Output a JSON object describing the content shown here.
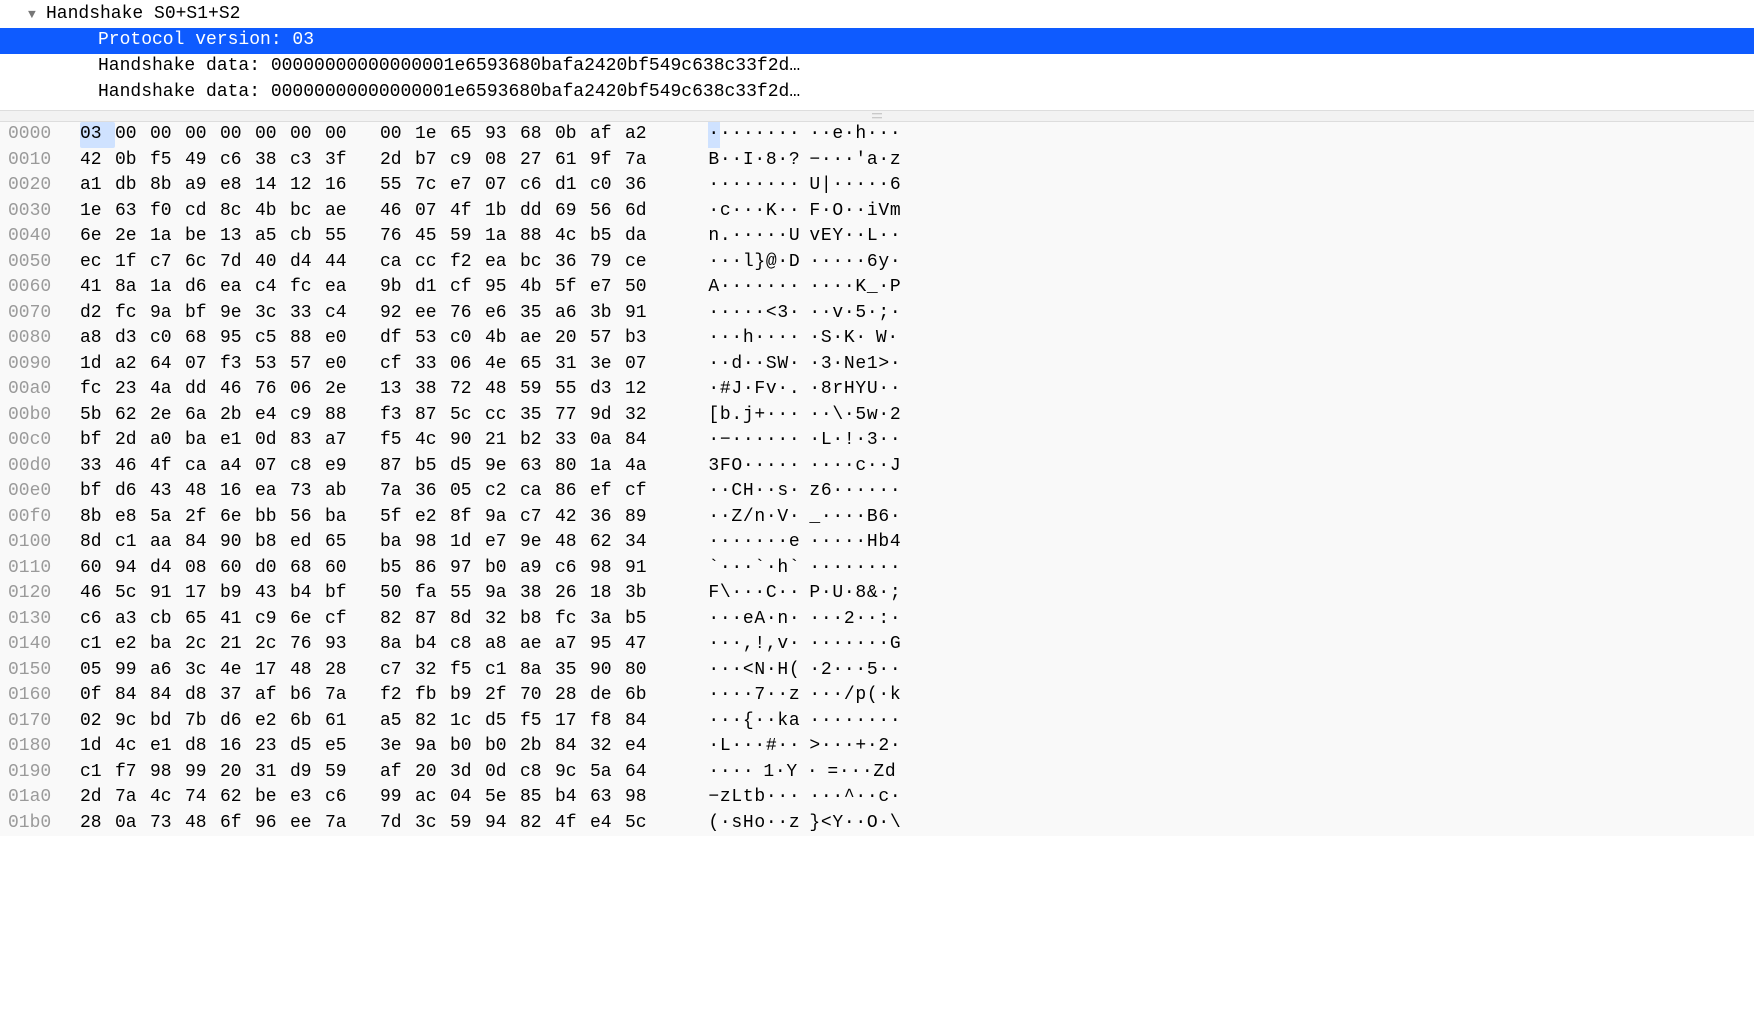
{
  "tree": {
    "root": {
      "label": "Handshake S0+S1+S2"
    },
    "version": {
      "label": "Protocol version: 03"
    },
    "hdata1": {
      "label": "Handshake data: 00000000000000001e6593680bafa2420bf549c638c33f2d…"
    },
    "hdata2": {
      "label": "Handshake data: 00000000000000001e6593680bafa2420bf549c638c33f2d…"
    }
  },
  "hex": {
    "selected": {
      "row": 0,
      "col": 0
    },
    "rows": [
      {
        "off": "0000",
        "b": [
          "03",
          "00",
          "00",
          "00",
          "00",
          "00",
          "00",
          "00",
          "00",
          "1e",
          "65",
          "93",
          "68",
          "0b",
          "af",
          "a2"
        ],
        "a": "········ ··e·h···"
      },
      {
        "off": "0010",
        "b": [
          "42",
          "0b",
          "f5",
          "49",
          "c6",
          "38",
          "c3",
          "3f",
          "2d",
          "b7",
          "c9",
          "08",
          "27",
          "61",
          "9f",
          "7a"
        ],
        "a": "B··I·8·? −···'a·z"
      },
      {
        "off": "0020",
        "b": [
          "a1",
          "db",
          "8b",
          "a9",
          "e8",
          "14",
          "12",
          "16",
          "55",
          "7c",
          "e7",
          "07",
          "c6",
          "d1",
          "c0",
          "36"
        ],
        "a": "········ U|·····6"
      },
      {
        "off": "0030",
        "b": [
          "1e",
          "63",
          "f0",
          "cd",
          "8c",
          "4b",
          "bc",
          "ae",
          "46",
          "07",
          "4f",
          "1b",
          "dd",
          "69",
          "56",
          "6d"
        ],
        "a": "·c···K·· F·O··iVm"
      },
      {
        "off": "0040",
        "b": [
          "6e",
          "2e",
          "1a",
          "be",
          "13",
          "a5",
          "cb",
          "55",
          "76",
          "45",
          "59",
          "1a",
          "88",
          "4c",
          "b5",
          "da"
        ],
        "a": "n.·····U vEY··L··"
      },
      {
        "off": "0050",
        "b": [
          "ec",
          "1f",
          "c7",
          "6c",
          "7d",
          "40",
          "d4",
          "44",
          "ca",
          "cc",
          "f2",
          "ea",
          "bc",
          "36",
          "79",
          "ce"
        ],
        "a": "···l}@·D ·····6y·"
      },
      {
        "off": "0060",
        "b": [
          "41",
          "8a",
          "1a",
          "d6",
          "ea",
          "c4",
          "fc",
          "ea",
          "9b",
          "d1",
          "cf",
          "95",
          "4b",
          "5f",
          "e7",
          "50"
        ],
        "a": "A······· ····K_·P"
      },
      {
        "off": "0070",
        "b": [
          "d2",
          "fc",
          "9a",
          "bf",
          "9e",
          "3c",
          "33",
          "c4",
          "92",
          "ee",
          "76",
          "e6",
          "35",
          "a6",
          "3b",
          "91"
        ],
        "a": "·····<3· ··v·5·;·"
      },
      {
        "off": "0080",
        "b": [
          "a8",
          "d3",
          "c0",
          "68",
          "95",
          "c5",
          "88",
          "e0",
          "df",
          "53",
          "c0",
          "4b",
          "ae",
          "20",
          "57",
          "b3"
        ],
        "a": "···h···· ·S·K· W·"
      },
      {
        "off": "0090",
        "b": [
          "1d",
          "a2",
          "64",
          "07",
          "f3",
          "53",
          "57",
          "e0",
          "cf",
          "33",
          "06",
          "4e",
          "65",
          "31",
          "3e",
          "07"
        ],
        "a": "··d··SW· ·3·Ne1>·"
      },
      {
        "off": "00a0",
        "b": [
          "fc",
          "23",
          "4a",
          "dd",
          "46",
          "76",
          "06",
          "2e",
          "13",
          "38",
          "72",
          "48",
          "59",
          "55",
          "d3",
          "12"
        ],
        "a": "·#J·Fv·. ·8rHYU··"
      },
      {
        "off": "00b0",
        "b": [
          "5b",
          "62",
          "2e",
          "6a",
          "2b",
          "e4",
          "c9",
          "88",
          "f3",
          "87",
          "5c",
          "cc",
          "35",
          "77",
          "9d",
          "32"
        ],
        "a": "[b.j+··· ··\\·5w·2"
      },
      {
        "off": "00c0",
        "b": [
          "bf",
          "2d",
          "a0",
          "ba",
          "e1",
          "0d",
          "83",
          "a7",
          "f5",
          "4c",
          "90",
          "21",
          "b2",
          "33",
          "0a",
          "84"
        ],
        "a": "·−······ ·L·!·3··"
      },
      {
        "off": "00d0",
        "b": [
          "33",
          "46",
          "4f",
          "ca",
          "a4",
          "07",
          "c8",
          "e9",
          "87",
          "b5",
          "d5",
          "9e",
          "63",
          "80",
          "1a",
          "4a"
        ],
        "a": "3FO····· ····c··J"
      },
      {
        "off": "00e0",
        "b": [
          "bf",
          "d6",
          "43",
          "48",
          "16",
          "ea",
          "73",
          "ab",
          "7a",
          "36",
          "05",
          "c2",
          "ca",
          "86",
          "ef",
          "cf"
        ],
        "a": "··CH··s· z6······"
      },
      {
        "off": "00f0",
        "b": [
          "8b",
          "e8",
          "5a",
          "2f",
          "6e",
          "bb",
          "56",
          "ba",
          "5f",
          "e2",
          "8f",
          "9a",
          "c7",
          "42",
          "36",
          "89"
        ],
        "a": "··Z/n·V· _····B6·"
      },
      {
        "off": "0100",
        "b": [
          "8d",
          "c1",
          "aa",
          "84",
          "90",
          "b8",
          "ed",
          "65",
          "ba",
          "98",
          "1d",
          "e7",
          "9e",
          "48",
          "62",
          "34"
        ],
        "a": "·······e ·····Hb4"
      },
      {
        "off": "0110",
        "b": [
          "60",
          "94",
          "d4",
          "08",
          "60",
          "d0",
          "68",
          "60",
          "b5",
          "86",
          "97",
          "b0",
          "a9",
          "c6",
          "98",
          "91"
        ],
        "a": "`···`·h` ········"
      },
      {
        "off": "0120",
        "b": [
          "46",
          "5c",
          "91",
          "17",
          "b9",
          "43",
          "b4",
          "bf",
          "50",
          "fa",
          "55",
          "9a",
          "38",
          "26",
          "18",
          "3b"
        ],
        "a": "F\\···C·· P·U·8&·;"
      },
      {
        "off": "0130",
        "b": [
          "c6",
          "a3",
          "cb",
          "65",
          "41",
          "c9",
          "6e",
          "cf",
          "82",
          "87",
          "8d",
          "32",
          "b8",
          "fc",
          "3a",
          "b5"
        ],
        "a": "···eA·n· ···2··:·"
      },
      {
        "off": "0140",
        "b": [
          "c1",
          "e2",
          "ba",
          "2c",
          "21",
          "2c",
          "76",
          "93",
          "8a",
          "b4",
          "c8",
          "a8",
          "ae",
          "a7",
          "95",
          "47"
        ],
        "a": "···,!,v· ·······G"
      },
      {
        "off": "0150",
        "b": [
          "05",
          "99",
          "a6",
          "3c",
          "4e",
          "17",
          "48",
          "28",
          "c7",
          "32",
          "f5",
          "c1",
          "8a",
          "35",
          "90",
          "80"
        ],
        "a": "···<N·H( ·2···5··"
      },
      {
        "off": "0160",
        "b": [
          "0f",
          "84",
          "84",
          "d8",
          "37",
          "af",
          "b6",
          "7a",
          "f2",
          "fb",
          "b9",
          "2f",
          "70",
          "28",
          "de",
          "6b"
        ],
        "a": "····7··z ···/p(·k"
      },
      {
        "off": "0170",
        "b": [
          "02",
          "9c",
          "bd",
          "7b",
          "d6",
          "e2",
          "6b",
          "61",
          "a5",
          "82",
          "1c",
          "d5",
          "f5",
          "17",
          "f8",
          "84"
        ],
        "a": "···{··ka ········"
      },
      {
        "off": "0180",
        "b": [
          "1d",
          "4c",
          "e1",
          "d8",
          "16",
          "23",
          "d5",
          "e5",
          "3e",
          "9a",
          "b0",
          "b0",
          "2b",
          "84",
          "32",
          "e4"
        ],
        "a": "·L···#·· >···+·2·"
      },
      {
        "off": "0190",
        "b": [
          "c1",
          "f7",
          "98",
          "99",
          "20",
          "31",
          "d9",
          "59",
          "af",
          "20",
          "3d",
          "0d",
          "c8",
          "9c",
          "5a",
          "64"
        ],
        "a": "···· 1·Y · =···Zd"
      },
      {
        "off": "01a0",
        "b": [
          "2d",
          "7a",
          "4c",
          "74",
          "62",
          "be",
          "e3",
          "c6",
          "99",
          "ac",
          "04",
          "5e",
          "85",
          "b4",
          "63",
          "98"
        ],
        "a": "−zLtb··· ···^··c·"
      },
      {
        "off": "01b0",
        "b": [
          "28",
          "0a",
          "73",
          "48",
          "6f",
          "96",
          "ee",
          "7a",
          "7d",
          "3c",
          "59",
          "94",
          "82",
          "4f",
          "e4",
          "5c"
        ],
        "a": "(·sHo··z }<Y··O·\\"
      }
    ]
  }
}
